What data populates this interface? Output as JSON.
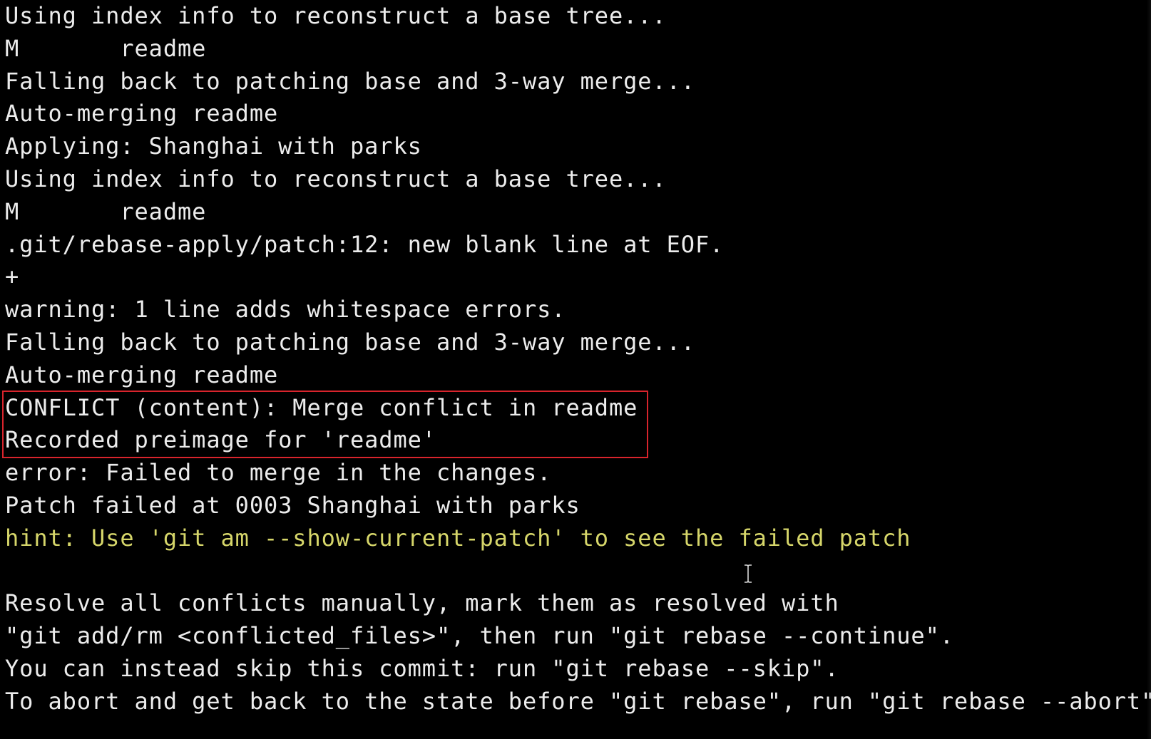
{
  "terminal": {
    "lines": [
      {
        "text": "Using index info to reconstruct a base tree...",
        "style": "normal"
      },
      {
        "text": "M       readme",
        "style": "normal"
      },
      {
        "text": "Falling back to patching base and 3-way merge...",
        "style": "normal"
      },
      {
        "text": "Auto-merging readme",
        "style": "normal"
      },
      {
        "text": "Applying: Shanghai with parks",
        "style": "normal"
      },
      {
        "text": "Using index info to reconstruct a base tree...",
        "style": "normal"
      },
      {
        "text": "M       readme",
        "style": "normal"
      },
      {
        "text": ".git/rebase-apply/patch:12: new blank line at EOF.",
        "style": "normal"
      },
      {
        "text": "+",
        "style": "normal"
      },
      {
        "text": "warning: 1 line adds whitespace errors.",
        "style": "normal"
      },
      {
        "text": "Falling back to patching base and 3-way merge...",
        "style": "normal"
      },
      {
        "text": "Auto-merging readme",
        "style": "normal"
      },
      {
        "text": "CONFLICT (content): Merge conflict in readme",
        "style": "normal"
      },
      {
        "text": "Recorded preimage for 'readme'",
        "style": "normal"
      },
      {
        "text": "error: Failed to merge in the changes.",
        "style": "normal"
      },
      {
        "text": "Patch failed at 0003 Shanghai with parks",
        "style": "normal"
      },
      {
        "text": "hint: Use 'git am --show-current-patch' to see the failed patch",
        "style": "hint"
      },
      {
        "text": "",
        "style": "normal"
      },
      {
        "text": "Resolve all conflicts manually, mark them as resolved with",
        "style": "normal"
      },
      {
        "text": "\"git add/rm <conflicted_files>\", then run \"git rebase --continue\".",
        "style": "normal"
      },
      {
        "text": "You can instead skip this commit: run \"git rebase --skip\".",
        "style": "normal"
      },
      {
        "text": "To abort and get back to the state before \"git rebase\", run \"git rebase --abort\".",
        "style": "normal"
      }
    ]
  },
  "colors": {
    "background": "#000000",
    "text": "#ececec",
    "hint": "#d6d66a",
    "highlight_border": "#d8242c"
  },
  "icons": {
    "cursor": "i-beam-cursor-icon"
  }
}
